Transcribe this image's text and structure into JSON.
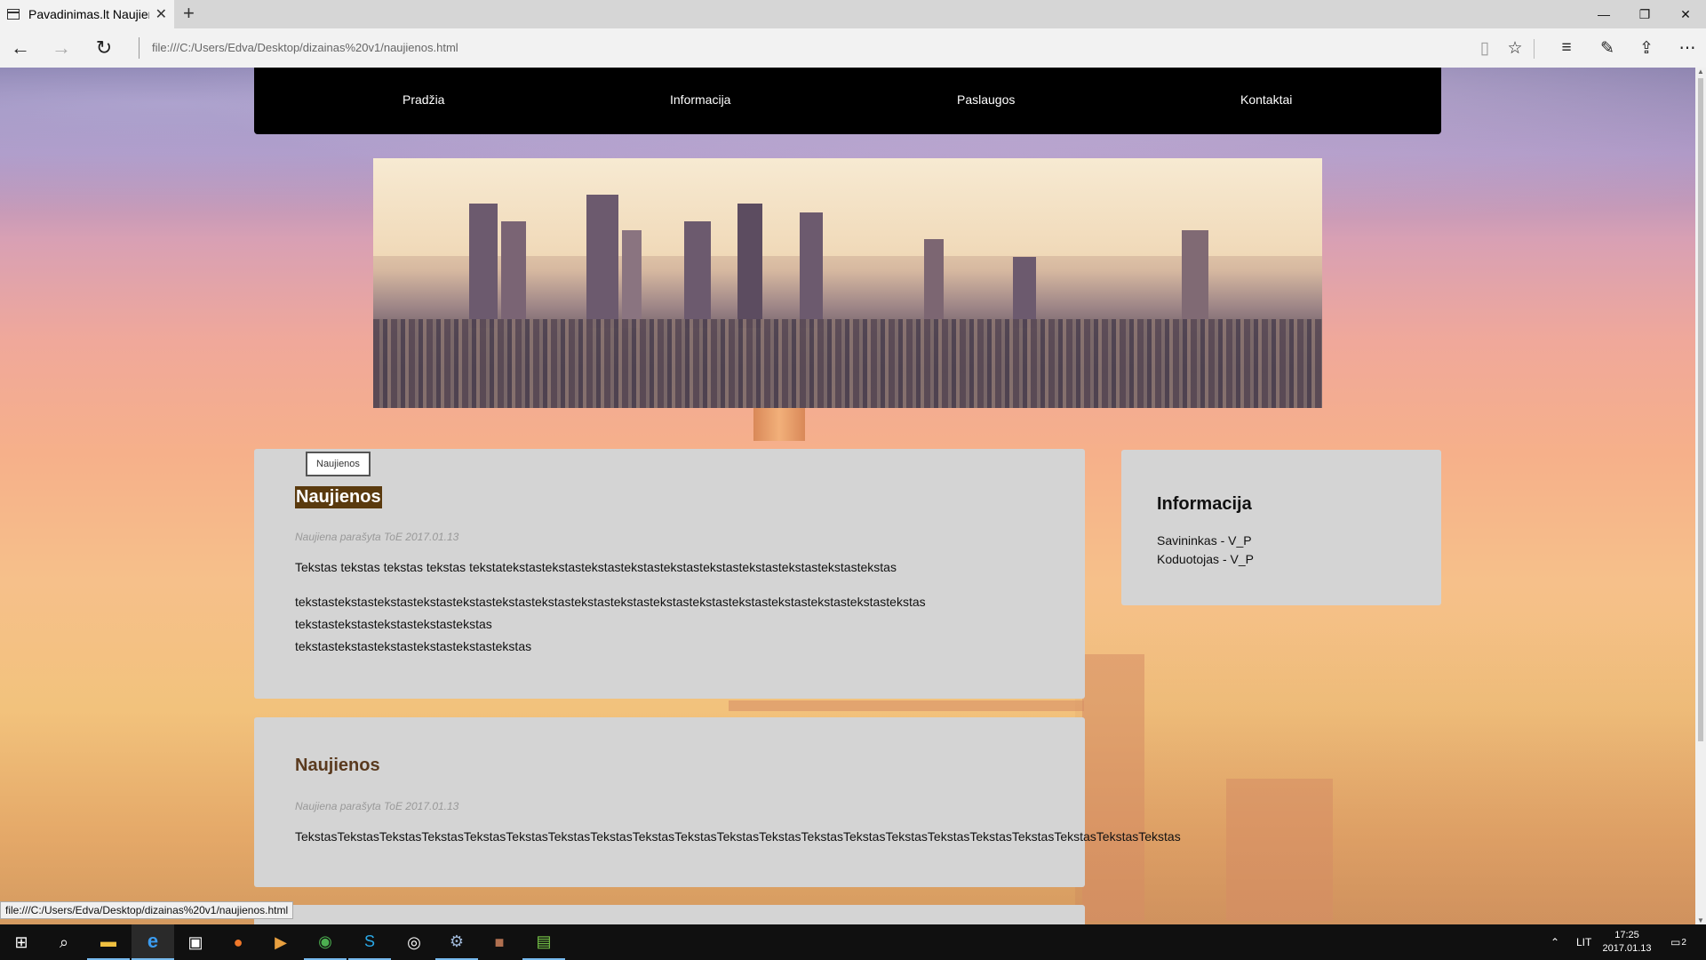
{
  "browser": {
    "tab_title": "Pavadinimas.lt Naujienos",
    "url": "file:///C:/Users/Edva/Desktop/dizainas%20v1/naujienos.html",
    "status_link": "file:///C:/Users/Edva/Desktop/dizainas%20v1/naujienos.html"
  },
  "nav": {
    "items": [
      "Pradžia",
      "Informacija",
      "Paslaugos",
      "Kontaktai"
    ]
  },
  "news": [
    {
      "tag": "Naujienos",
      "title": "Naujienos",
      "meta": "Naujiena parašyta ToE 2017.01.13",
      "paragraph1": "Tekstas tekstas tekstas tekstas tekstatekstastekstastekstastekstastekstastekstastekstastekstastekstastekstas",
      "lines": [
        "tekstastekstastekstastekstastekstastekstastekstastekstastekstastekstastekstastekstastekstastekstastekstastekstas",
        "tekstastekstastekstastekstastekstas",
        "tekstastekstastekstastekstastekstastekstas"
      ]
    },
    {
      "title": "Naujienos",
      "meta": "Naujiena parašyta ToE 2017.01.13",
      "paragraph1": "TekstasTekstasTekstasTekstasTekstasTekstasTekstasTekstasTekstasTekstasTekstasTekstasTekstasTekstasTekstasTekstasTekstasTekstasTekstasTekstasTekstas"
    }
  ],
  "sidebar": {
    "title": "Informacija",
    "owner": "Savininkas - V_P",
    "coder": "Koduotojas - V_P"
  },
  "taskbar": {
    "language": "LIT",
    "time": "17:25",
    "date": "2017.01.13",
    "notifications": "2"
  },
  "icons": [
    "page-icon",
    "close-icon",
    "new-tab-icon",
    "minimize-icon",
    "restore-icon",
    "back-icon",
    "forward-icon",
    "refresh-icon",
    "reading-view-icon",
    "favorite-star-icon",
    "hub-icon",
    "web-note-icon",
    "share-icon",
    "more-icon",
    "windows-start-icon",
    "search-icon",
    "file-explorer-icon",
    "edge-icon",
    "store-icon",
    "firefox-icon",
    "media-player-icon",
    "chrome-icon",
    "skype-icon",
    "disc-app-icon",
    "steam-icon",
    "game-icon",
    "notepad-icon",
    "tray-chevron-icon",
    "action-center-icon"
  ]
}
